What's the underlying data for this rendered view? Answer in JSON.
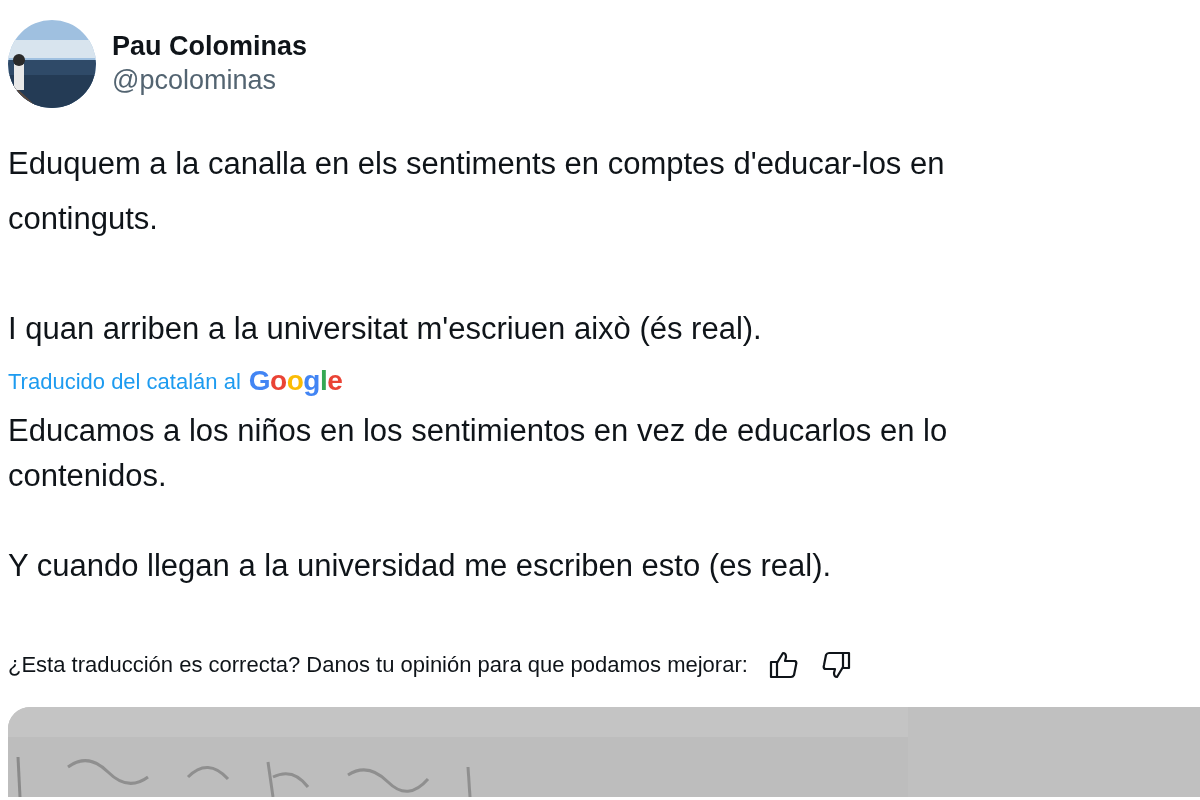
{
  "author": {
    "name": "Pau Colominas",
    "handle": "@pcolominas"
  },
  "tweet_text": "Eduquem a la canalla en els sentiments en comptes d'educar-los en\ncontinguts.\n\nI quan arriben a la universitat m'escriuen això (és real).",
  "translation": {
    "label": "Traducido del catalán al",
    "provider": "Google",
    "text": "Educamos a los niños en los sentimientos en vez de educarlos en lo\ncontenidos.\n\nY cuando llegan a la universidad me escriben esto (es real).",
    "feedback": "¿Esta traducción es correcta? Danos tu opinión para que podamos mejorar:"
  }
}
